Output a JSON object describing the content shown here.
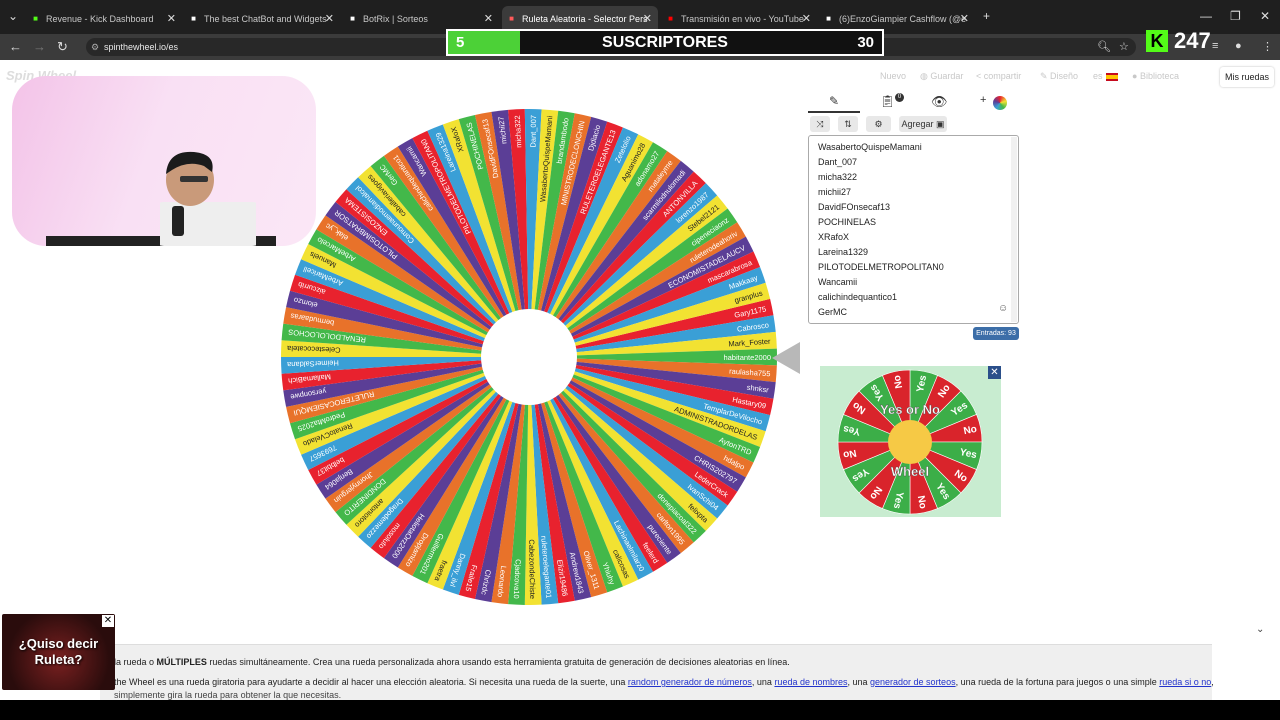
{
  "browser": {
    "tabs": [
      {
        "title": "Revenue - Kick Dashboard",
        "icon": "kick-icon",
        "color": "#53fc18",
        "active": false
      },
      {
        "title": "The best ChatBot and Widgets",
        "icon": "botrix-icon",
        "color": "#ffffff",
        "active": false
      },
      {
        "title": "BotRix | Sorteos",
        "icon": "botrix-icon",
        "color": "#ffffff",
        "active": false
      },
      {
        "title": "Ruleta Aleatoria - Selector Pers",
        "icon": "wheel-icon",
        "color": "#ff5a5a",
        "active": true
      },
      {
        "title": "Transmisión en vivo - YouTube",
        "icon": "youtube-icon",
        "color": "#ff0000",
        "active": false
      },
      {
        "title": "(6)EnzoGiampier Cashflow (@e",
        "icon": "tiktok-icon",
        "color": "#ffffff",
        "active": false
      }
    ],
    "new_tab": "+",
    "url": "spinthewheel.io/es"
  },
  "overlay": {
    "current": "5",
    "label": "SUSCRIPTORES",
    "goal": "30",
    "fraction": 0.1667,
    "kick_count": "247"
  },
  "site": {
    "logo": "Spin Wheel",
    "menu": [
      {
        "label": "Nuevo",
        "icon": ""
      },
      {
        "label": "Guardar",
        "icon": "save-icon"
      },
      {
        "label": "compartir",
        "icon": "share-icon"
      },
      {
        "label": "Diseño",
        "icon": "pencil-icon"
      },
      {
        "label": "es",
        "icon": "spain-flag-icon"
      },
      {
        "label": "Biblioteca",
        "icon": "globe-icon"
      }
    ],
    "mis_ruedas": "Mis ruedas"
  },
  "panel": {
    "results_badge": "0",
    "agregar": "Agregar",
    "count_badge": "Entradas: 93",
    "entries": [
      "WasabertoQuispeMamani",
      "Dant_007",
      "micha322",
      "michii27",
      "DavidFOnsecaf13",
      "POCHINELAS",
      "XRafoX",
      "Lareina1329",
      "PILOTODELMETROPOLITAN0",
      "Wancamii",
      "calichindequantico1",
      "GerMC"
    ]
  },
  "wheel": {
    "segment_colors": [
      "#e8222e",
      "#3a9fd6",
      "#f2e232",
      "#43b84a",
      "#e8722a",
      "#5b3e96"
    ],
    "labels": [
      "Gary1175",
      "Cabrosco",
      "Mark_Foster",
      "habitante2000",
      "raulasha755",
      "shnksr",
      "Hastary09",
      "TemplarDeVilocho",
      "ADMINISTRADORDELAS",
      "AytonTRD",
      "hdalpo",
      "CHRIS202797",
      "LederCrack",
      "IvanSchi04",
      "felixpta",
      "donepiacoal322",
      "carlton1995",
      "pureciente",
      "feelerd",
      "Lachinaelmilarz0",
      "calicosas",
      "Yhiuhy",
      "Oliver_1311",
      "Andrew1843",
      "Elizir19486",
      "ruleteroelegante01",
      "CabezondeChiste",
      "Cjadcova10",
      "Leonardo",
      "Chrizdc",
      "Fraile15",
      "Danny_ilvl",
      "fraetra",
      "Guillermo201",
      "Dropjamizo",
      "HeliotaOrz2000",
      "mosoluto",
      "Dragodemezzo",
      "antoniotoro",
      "DONDINERITO",
      "Jhonnyjerguin",
      "Benja064",
      "belbbit37",
      "7693657",
      "RenatoCVelado",
      "PedroMta2025",
      "RULETEROCASIEMQUI",
      "yersonpwe",
      "MallamaBich",
      "HeimerSaldana",
      "Celestecocatela",
      "RENALDOLOLOCHOS",
      "bermudaaras",
      "elomzo",
      "aizcurrib",
      "ArbeMaricell",
      "Manuels",
      "ArbeMarcelo",
      "elak_yc",
      "PILOTOSIMBRATSOR",
      "ENZOSISTEMA",
      "Comounaemodiamalcol",
      "caballeriavigoes",
      "GerMC",
      "calichindequantico1",
      "Wancamii",
      "PILOTODELMETROPOLITAN0",
      "Lareina1329",
      "XRafoX",
      "POCHINELAS",
      "DavidFOnsecaf13",
      "michii27",
      "micha322",
      "Dant_007",
      "WasabertoQuispeMamani",
      "brandambodo",
      "MINISTRODECLONCHIN",
      "Djdiacio",
      "RULETEROELEGANTE13",
      "Zetelolio",
      "Aguanimo28",
      "adonamo27",
      "mataleyme",
      "scarmilodnulomadi",
      "ANTONVILLA",
      "lorenzo1987",
      "Stebel2121",
      "cipeneciaonz",
      "ruleterodeahoriv",
      "ECONOMISTADELAUCV",
      "mascarabrosa",
      "Makkaay",
      "granplus"
    ]
  },
  "ad": {
    "title": "Yes or No",
    "subtitle": "Wheel",
    "labels": [
      "Yes",
      "No"
    ],
    "close": "✕"
  },
  "footer": {
    "line1_a": "la rueda o ",
    "line1_b": "MÚLTIPLES",
    "line1_c": " ruedas simultáneamente. Crea una rueda personalizada ahora usando esta herramienta gratuita de generación de decisiones aleatorias en línea.",
    "line2_a": "the Wheel es una rueda giratoria para ayudarte a decidir al hacer una elección aleatoria. Si necesita una rueda de la suerte, una ",
    "link1": "random generador de números",
    "line2_b": ", una ",
    "link2": "rueda de nombres",
    "line2_c": ", una ",
    "link3": "generador de sorteos",
    "line2_d": ", una rueda de la fortuna para juegos o una simple ",
    "link4": "rueda si o no",
    "line2_e": ",",
    "line3": "simplemente gira la rueda para obtener la que necesitas."
  },
  "promo": {
    "text": "¿Quiso decir Ruleta?",
    "close": "✕"
  }
}
